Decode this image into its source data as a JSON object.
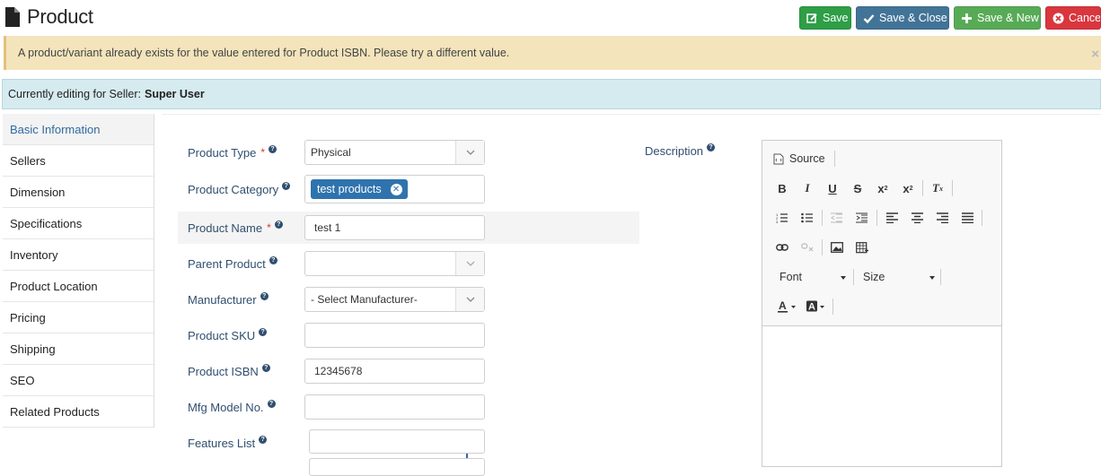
{
  "header": {
    "title": "Product",
    "icon": "document-icon"
  },
  "toolbar": {
    "save": "Save",
    "save_close": "Save & Close",
    "save_new": "Save & New",
    "cancel": "Cancel"
  },
  "alert": {
    "message": "A product/variant already exists for the value entered for Product ISBN. Please try a different value.",
    "close": "×"
  },
  "seller": {
    "prefix": "Currently editing for Seller:",
    "name": "Super User"
  },
  "nav": [
    "Basic Information",
    "Sellers",
    "Dimension",
    "Specifications",
    "Inventory",
    "Product Location",
    "Pricing",
    "Shipping",
    "SEO",
    "Related Products"
  ],
  "form": {
    "product_type": {
      "label": "Product Type",
      "required": "*",
      "value": "Physical"
    },
    "product_category": {
      "label": "Product Category",
      "tag": "test products"
    },
    "product_name": {
      "label": "Product Name",
      "required": "*",
      "value": "test 1"
    },
    "parent_product": {
      "label": "Parent Product",
      "value": ""
    },
    "manufacturer": {
      "label": "Manufacturer",
      "value": "- Select Manufacturer-"
    },
    "product_sku": {
      "label": "Product SKU",
      "value": ""
    },
    "product_isbn": {
      "label": "Product ISBN",
      "value": "12345678"
    },
    "mfg_model": {
      "label": "Mfg Model No.",
      "value": ""
    },
    "features_list": {
      "label": "Features List",
      "value": ""
    }
  },
  "description": {
    "label": "Description",
    "source_label": "Source",
    "font_label": "Font",
    "size_label": "Size"
  },
  "colors": {
    "save": "#2e9e47",
    "save_close": "#427497",
    "save_new": "#58ab56",
    "cancel": "#d9363e",
    "alert_bg": "#f3e4bc",
    "seller_bg": "#d6ebef",
    "tag": "#2f73ae"
  }
}
